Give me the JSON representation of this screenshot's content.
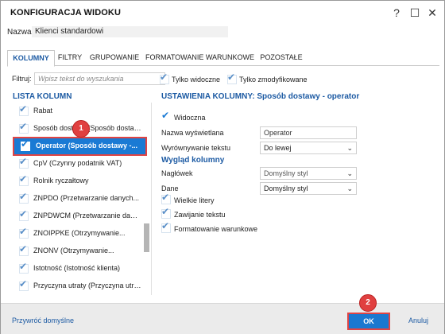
{
  "window": {
    "title": "KONFIGURACJA WIDOKU",
    "help_label": "?",
    "maximize_label": "☐",
    "close_label": "✕"
  },
  "name_field": {
    "label": "Nazwa:",
    "value": "Klienci standardowi"
  },
  "tabs": [
    {
      "label": "KOLUMNY",
      "active": true
    },
    {
      "label": "FILTRY",
      "active": false
    },
    {
      "label": "GRUPOWANIE",
      "active": false
    },
    {
      "label": "FORMATOWANIE WARUNKOWE",
      "active": false
    },
    {
      "label": "POZOSTAŁE",
      "active": false
    }
  ],
  "filter": {
    "label": "Filtruj:",
    "placeholder": "Wpisz tekst do wyszukania",
    "only_visible_label": "Tylko widoczne",
    "only_modified_label": "Tylko zmodyfikowane"
  },
  "column_list": {
    "title": "LISTA KOLUMN",
    "items": [
      {
        "label": "Rabat",
        "checked": true,
        "selected": false
      },
      {
        "label": "Sposób dostawy (Sposób dostawy...",
        "checked": true,
        "selected": false
      },
      {
        "label": "Operator (Sposób dostawy -...",
        "checked": true,
        "selected": true
      },
      {
        "label": "CpV (Czynny podatnik VAT)",
        "checked": true,
        "selected": false
      },
      {
        "label": "Rolnik ryczałtowy",
        "checked": true,
        "selected": false
      },
      {
        "label": "ZNPDO (Przetwarzanie danych...",
        "checked": true,
        "selected": false
      },
      {
        "label": "ZNPDWCM (Przetwarzanie danych...",
        "checked": true,
        "selected": false
      },
      {
        "label": "ZNOIPPKE (Otrzymywanie...",
        "checked": true,
        "selected": false
      },
      {
        "label": "ZNONV (Otrzymywanie...",
        "checked": true,
        "selected": false
      },
      {
        "label": "Istotność (Istotność klienta)",
        "checked": true,
        "selected": false
      },
      {
        "label": "Przyczyna utraty (Przyczyna utraty...",
        "checked": true,
        "selected": false
      }
    ]
  },
  "column_settings": {
    "title": "USTAWIENIA KOLUMNY: Sposób dostawy - operator",
    "visible_label": "Widoczna",
    "display_name_label": "Nazwa wyświetlana",
    "display_name_value": "Operator",
    "alignment_label": "Wyrównywanie tekstu",
    "alignment_value": "Do lewej",
    "appearance_title": "Wygląd kolumny",
    "header_label": "Nagłówek",
    "header_value": "Domyślny styl",
    "data_label": "Dane",
    "data_value": "Domyślny styl",
    "uppercase_label": "Wielkie litery",
    "wrap_label": "Zawijanie tekstu",
    "conditional_label": "Formatowanie warunkowe"
  },
  "footer": {
    "restore_label": "Przywróć domyślne",
    "ok_label": "OK",
    "cancel_label": "Anuluj"
  },
  "badges": {
    "step1": "1",
    "step2": "2"
  },
  "icons": {
    "checkbox": "check-icon",
    "chevron": "chevron-down-icon"
  },
  "colors": {
    "accent": "#1c5aa3",
    "selection": "#1a7ad4",
    "highlight": "#e04444",
    "checkbox_tick": "#5a8fc8"
  }
}
